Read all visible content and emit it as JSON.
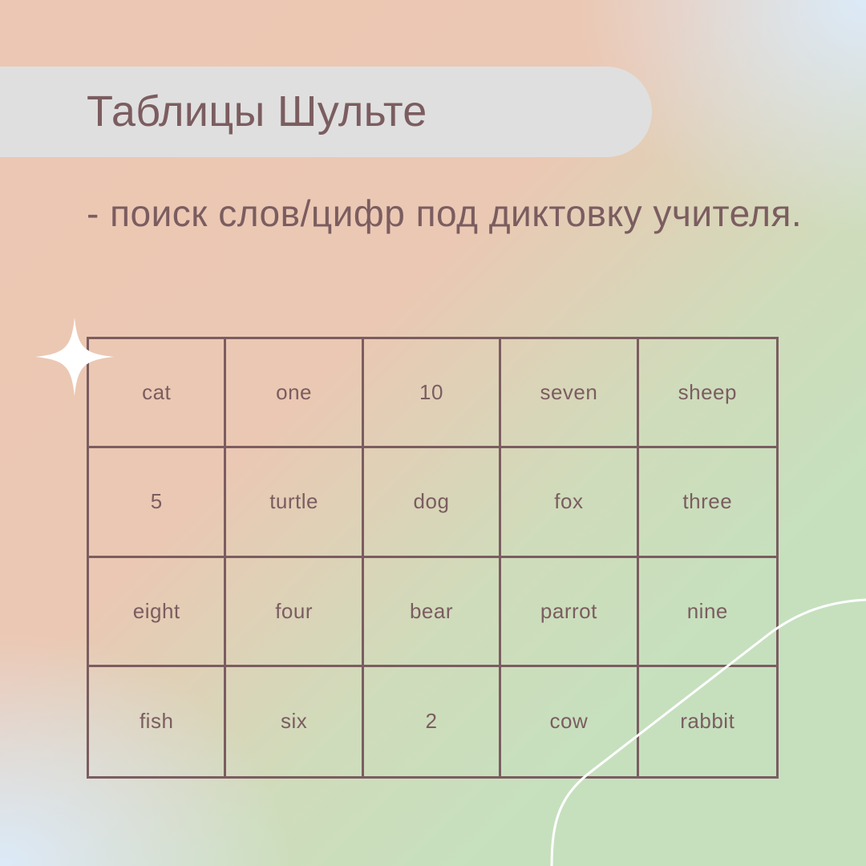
{
  "header": {
    "title": "Таблицы Шульте"
  },
  "description": {
    "text": "- поиск слов/цифр под диктовку учителя."
  },
  "table": {
    "rows": [
      [
        "cat",
        "one",
        "10",
        "seven",
        "sheep"
      ],
      [
        "5",
        "turtle",
        "dog",
        "fox",
        "three"
      ],
      [
        "eight",
        "four",
        "bear",
        "parrot",
        "nine"
      ],
      [
        "fish",
        "six",
        "2",
        "cow",
        "rabbit"
      ]
    ]
  },
  "decorations": {
    "sparkle": "four-point-star-icon",
    "curve": "decorative-curve"
  },
  "colors": {
    "text": "#7b5d60",
    "title_bg": "#e0dfdf",
    "peach": "#ebc8b3",
    "green": "#c6e0be",
    "blue": "#dceaf8"
  }
}
